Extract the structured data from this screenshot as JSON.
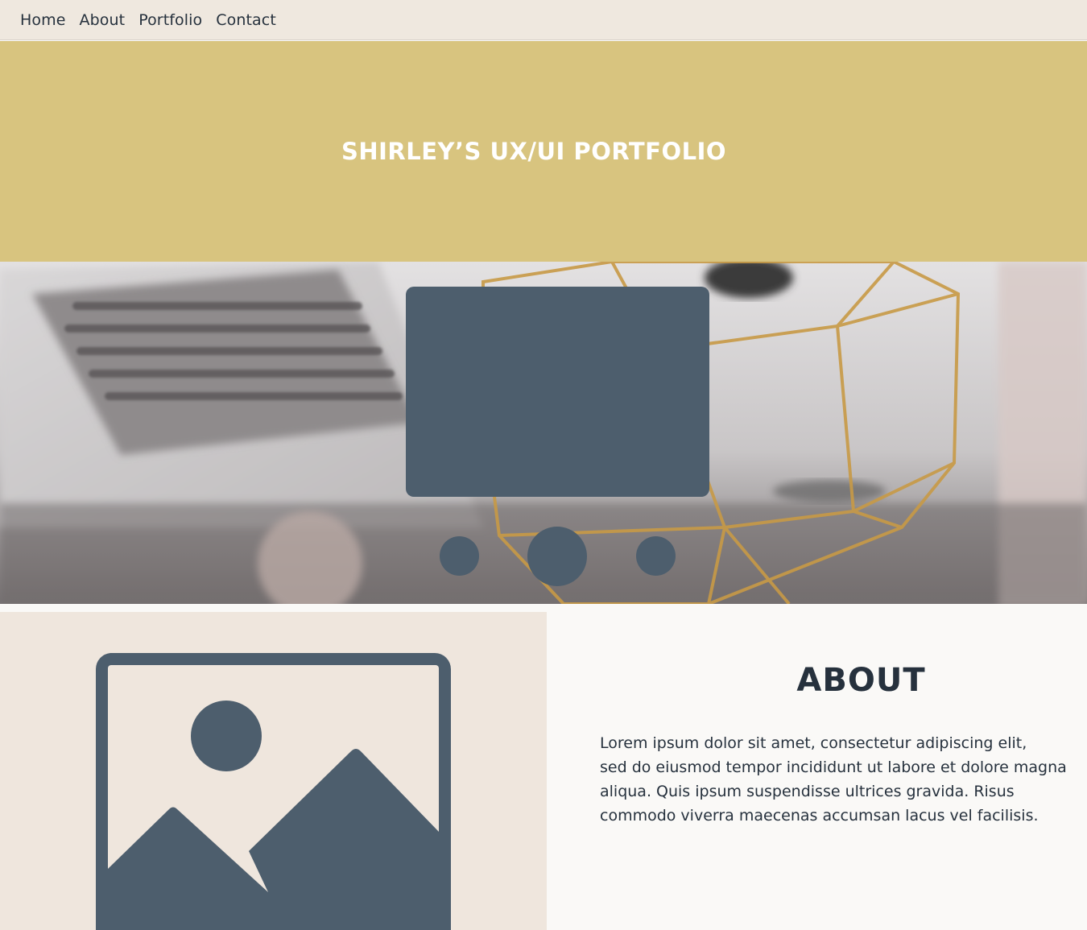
{
  "nav": {
    "items": [
      {
        "label": "Home"
      },
      {
        "label": "About"
      },
      {
        "label": "Portfolio"
      },
      {
        "label": "Contact"
      }
    ]
  },
  "hero": {
    "title": "SHIRLEY’S UX/UI PORTFOLIO",
    "background_color": "#d8c47f"
  },
  "carousel": {
    "background_image": "blurred-desk-photo",
    "slide_color": "#4d5e6d",
    "active_dot": 2,
    "dot_count": 3
  },
  "about": {
    "image_icon": "image-placeholder-icon",
    "heading": "ABOUT",
    "body": "Lorem ipsum dolor sit amet, consectetur adipiscing elit,\nsed do eiusmod tempor  incididunt ut labore et dolore magna\naliqua. Quis ipsum suspendisse ultrices gravida.  Risus\ncommodo viverra maecenas accumsan lacus vel facilisis."
  },
  "colors": {
    "nav_bg": "#efe8df",
    "accent": "#4d5e6d",
    "text": "#26313d",
    "panel_bg": "#efe6dd"
  }
}
